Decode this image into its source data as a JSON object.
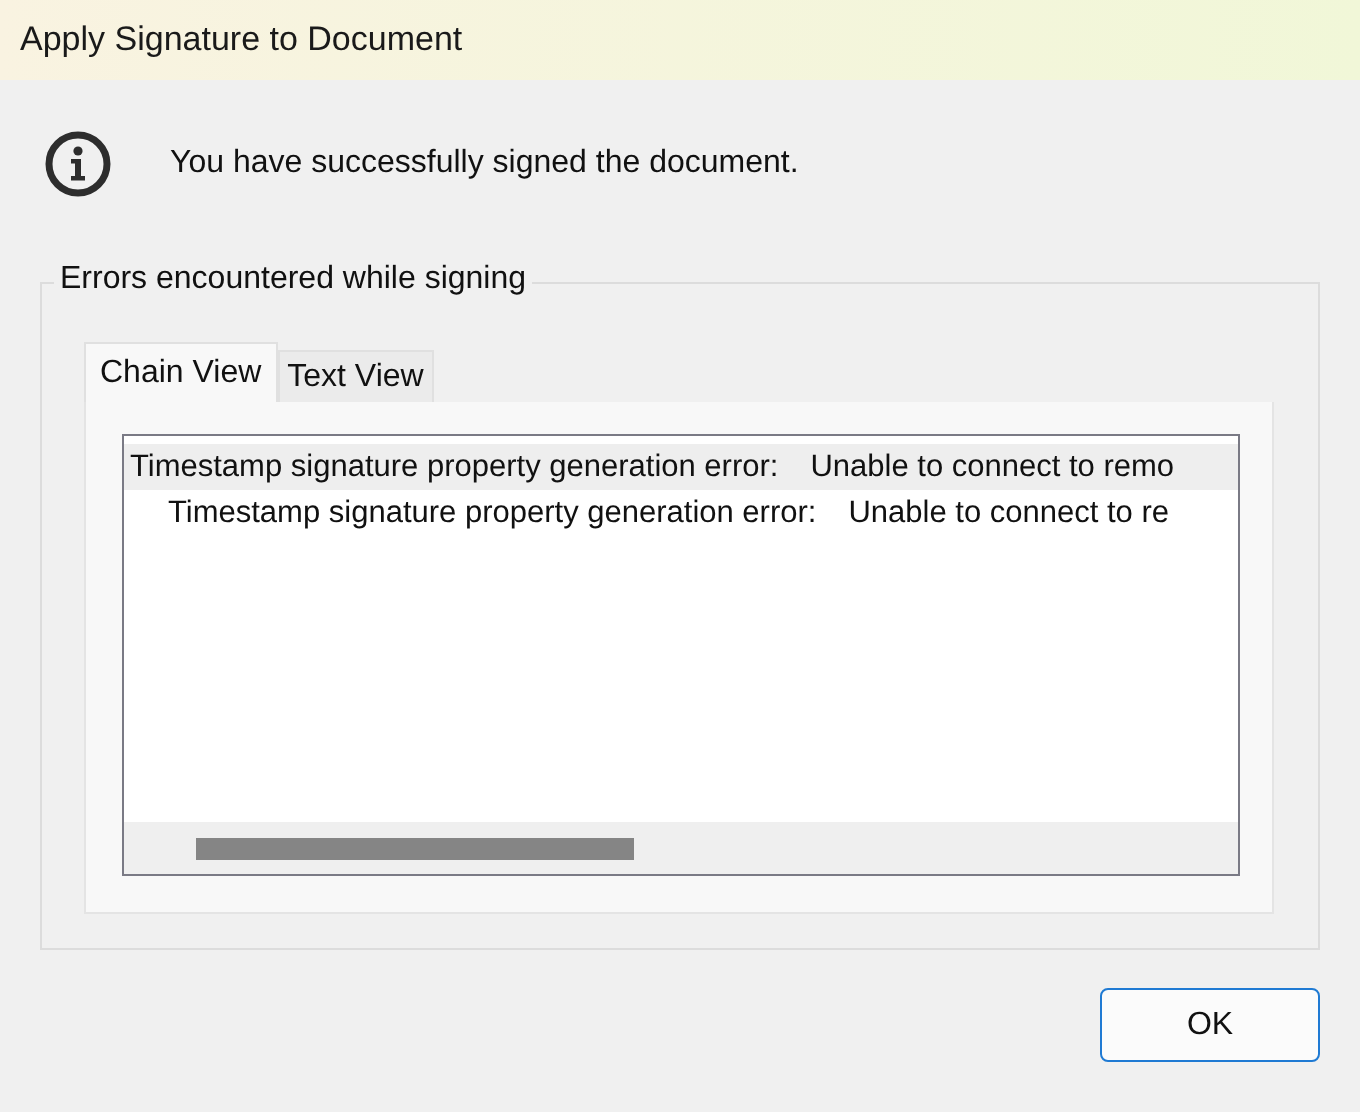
{
  "window": {
    "title": "Apply Signature to Document"
  },
  "message": "You have successfully signed the document.",
  "group": {
    "title": "Errors encountered while signing"
  },
  "tabs": [
    {
      "label": "Chain View",
      "selected": true
    },
    {
      "label": "Text View",
      "selected": false
    }
  ],
  "errors": [
    {
      "label": "Timestamp signature property generation error:",
      "message": "Unable to connect to remo",
      "selected": true,
      "children": [
        {
          "label": "Timestamp signature property generation error:",
          "message": "Unable to connect to re",
          "selected": false
        }
      ]
    }
  ],
  "buttons": [
    {
      "label": "OK"
    }
  ]
}
